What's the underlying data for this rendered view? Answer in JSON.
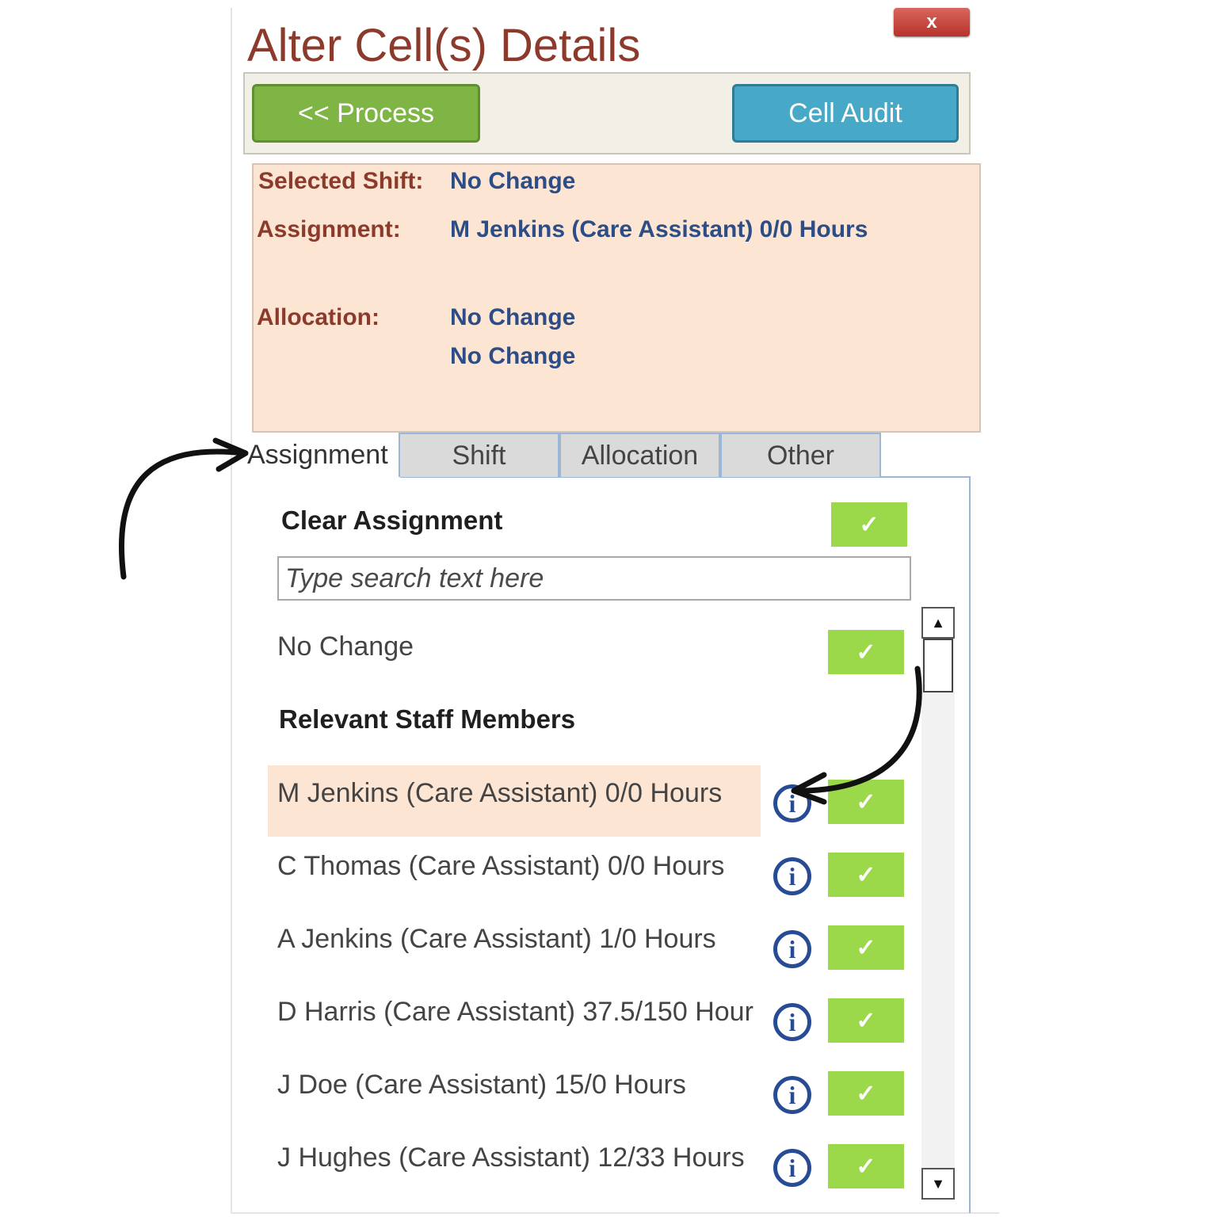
{
  "dialog": {
    "title": "Alter Cell(s) Details",
    "close_glyph": "x",
    "process_label": "<< Process",
    "audit_label": "Cell Audit"
  },
  "summary": {
    "selected_shift_label": "Selected Shift:",
    "selected_shift_value": "No Change",
    "assignment_label": "Assignment:",
    "assignment_value": "M Jenkins (Care Assistant) 0/0 Hours",
    "allocation_label": "Allocation:",
    "allocation_value_1": "No Change",
    "allocation_value_2": "No Change"
  },
  "tabs": {
    "assignment": "Assignment",
    "shift": "Shift",
    "allocation": "Allocation",
    "other": "Other",
    "active": "Assignment"
  },
  "assignment_panel": {
    "clear_label": "Clear Assignment",
    "search_placeholder": "Type search text here",
    "no_change_label": "No Change",
    "relevant_heading": "Relevant Staff Members",
    "check_glyph": "✓",
    "info_glyph": "i",
    "staff": [
      {
        "name": "M Jenkins (Care Assistant) 0/0 Hours"
      },
      {
        "name": "C Thomas (Care Assistant) 0/0 Hours"
      },
      {
        "name": "A Jenkins (Care Assistant) 1/0 Hours"
      },
      {
        "name": "D Harris (Care Assistant) 37.5/150 Hour"
      },
      {
        "name": "J Doe (Care Assistant) 15/0 Hours"
      },
      {
        "name": "J Hughes (Care Assistant) 12/33 Hours"
      }
    ]
  },
  "scrollbar": {
    "up_glyph": "▲",
    "down_glyph": "▼"
  },
  "colors": {
    "title": "#8b3a2b",
    "process": "#7fb545",
    "audit": "#47a9c7",
    "summary_bg": "#fde5d3",
    "value_text": "#2d4d86",
    "check_bg": "#9bd84a",
    "info": "#274c94"
  }
}
